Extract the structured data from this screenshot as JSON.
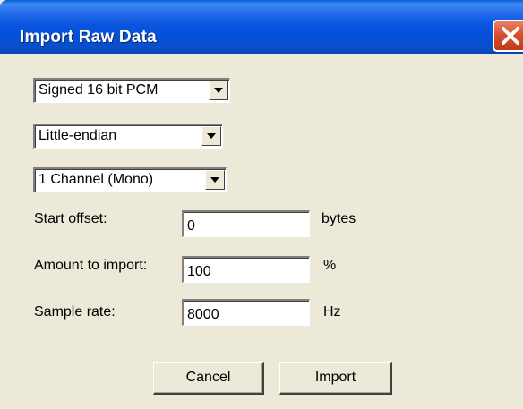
{
  "window": {
    "title": "Import Raw Data"
  },
  "format": {
    "encoding": "Signed 16 bit PCM",
    "byte_order": "Little-endian",
    "channels": "1 Channel (Mono)"
  },
  "fields": {
    "start_offset": {
      "label": "Start offset:",
      "value": "0",
      "unit": "bytes"
    },
    "amount": {
      "label": "Amount to import:",
      "value": "100",
      "unit": "%"
    },
    "sample_rate": {
      "label": "Sample rate:",
      "value": "8000",
      "unit": "Hz"
    }
  },
  "buttons": {
    "cancel": "Cancel",
    "import": "Import"
  },
  "icons": {
    "close": "close-icon",
    "dropdown": "chevron-down-icon"
  },
  "colors": {
    "titlebar": "#0a55df",
    "window_bg": "#ece9d8",
    "close_button": "#d8512c"
  }
}
